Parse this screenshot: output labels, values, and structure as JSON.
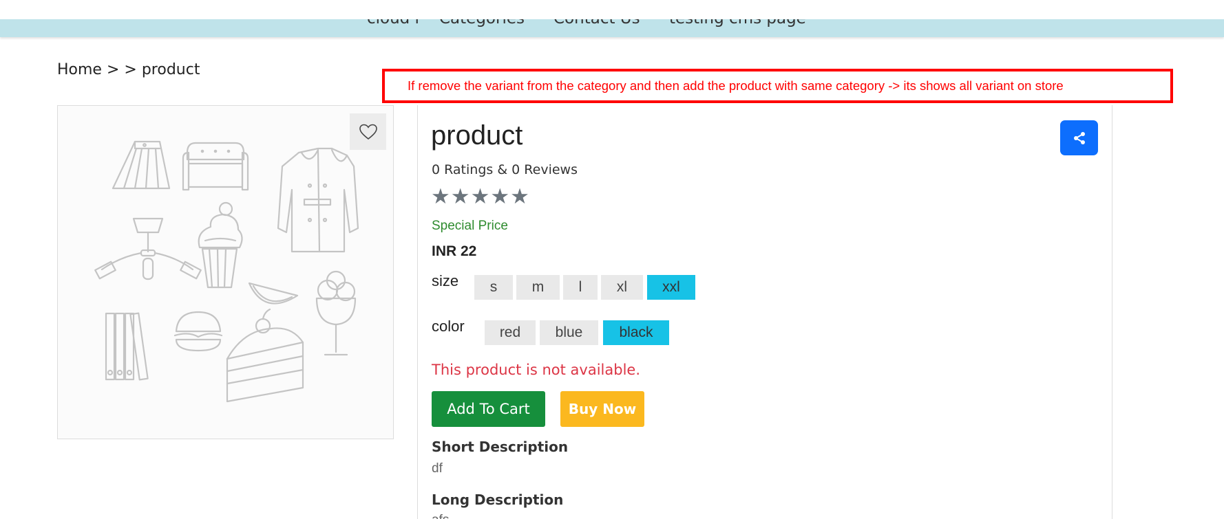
{
  "nav": {
    "items": [
      "cloud r",
      "Categories",
      "Contact Us",
      "testing cms page"
    ]
  },
  "breadcrumb": {
    "home": "Home",
    "sep1": ">",
    "sep2": ">",
    "current": "product"
  },
  "annotation": {
    "text": "If remove the variant from the category and then add the product with same category -> its shows all variant on store",
    "color": "#ff0000"
  },
  "product": {
    "title": "product",
    "ratings_text": "0 Ratings & 0 Reviews",
    "stars": "★★★★★",
    "special_label": "Special Price",
    "price": "INR 22",
    "availability": "This product is not available.",
    "image_icon": "product-placeholder-icon",
    "wishlist_icon": "heart-icon",
    "share_icon": "share-icon"
  },
  "options": {
    "size": {
      "label": "size",
      "values": [
        "s",
        "m",
        "l",
        "xl",
        "xxl"
      ],
      "selected": "xxl"
    },
    "color": {
      "label": "color",
      "values": [
        "red",
        "blue",
        "black"
      ],
      "selected": "black"
    }
  },
  "actions": {
    "add_to_cart": "Add To Cart",
    "buy_now": "Buy Now"
  },
  "description": {
    "short_title": "Short Description",
    "short_text": "df",
    "long_title": "Long Description",
    "long_text": "afs"
  },
  "colors": {
    "nav_bg": "#bfe3ea",
    "accent": "#17c2e6",
    "share_bg": "#0d6efd",
    "cart_bg": "#168f3c",
    "buy_bg": "#fbb81f",
    "unavailable": "#dc3545",
    "special": "#2e8b2e"
  }
}
